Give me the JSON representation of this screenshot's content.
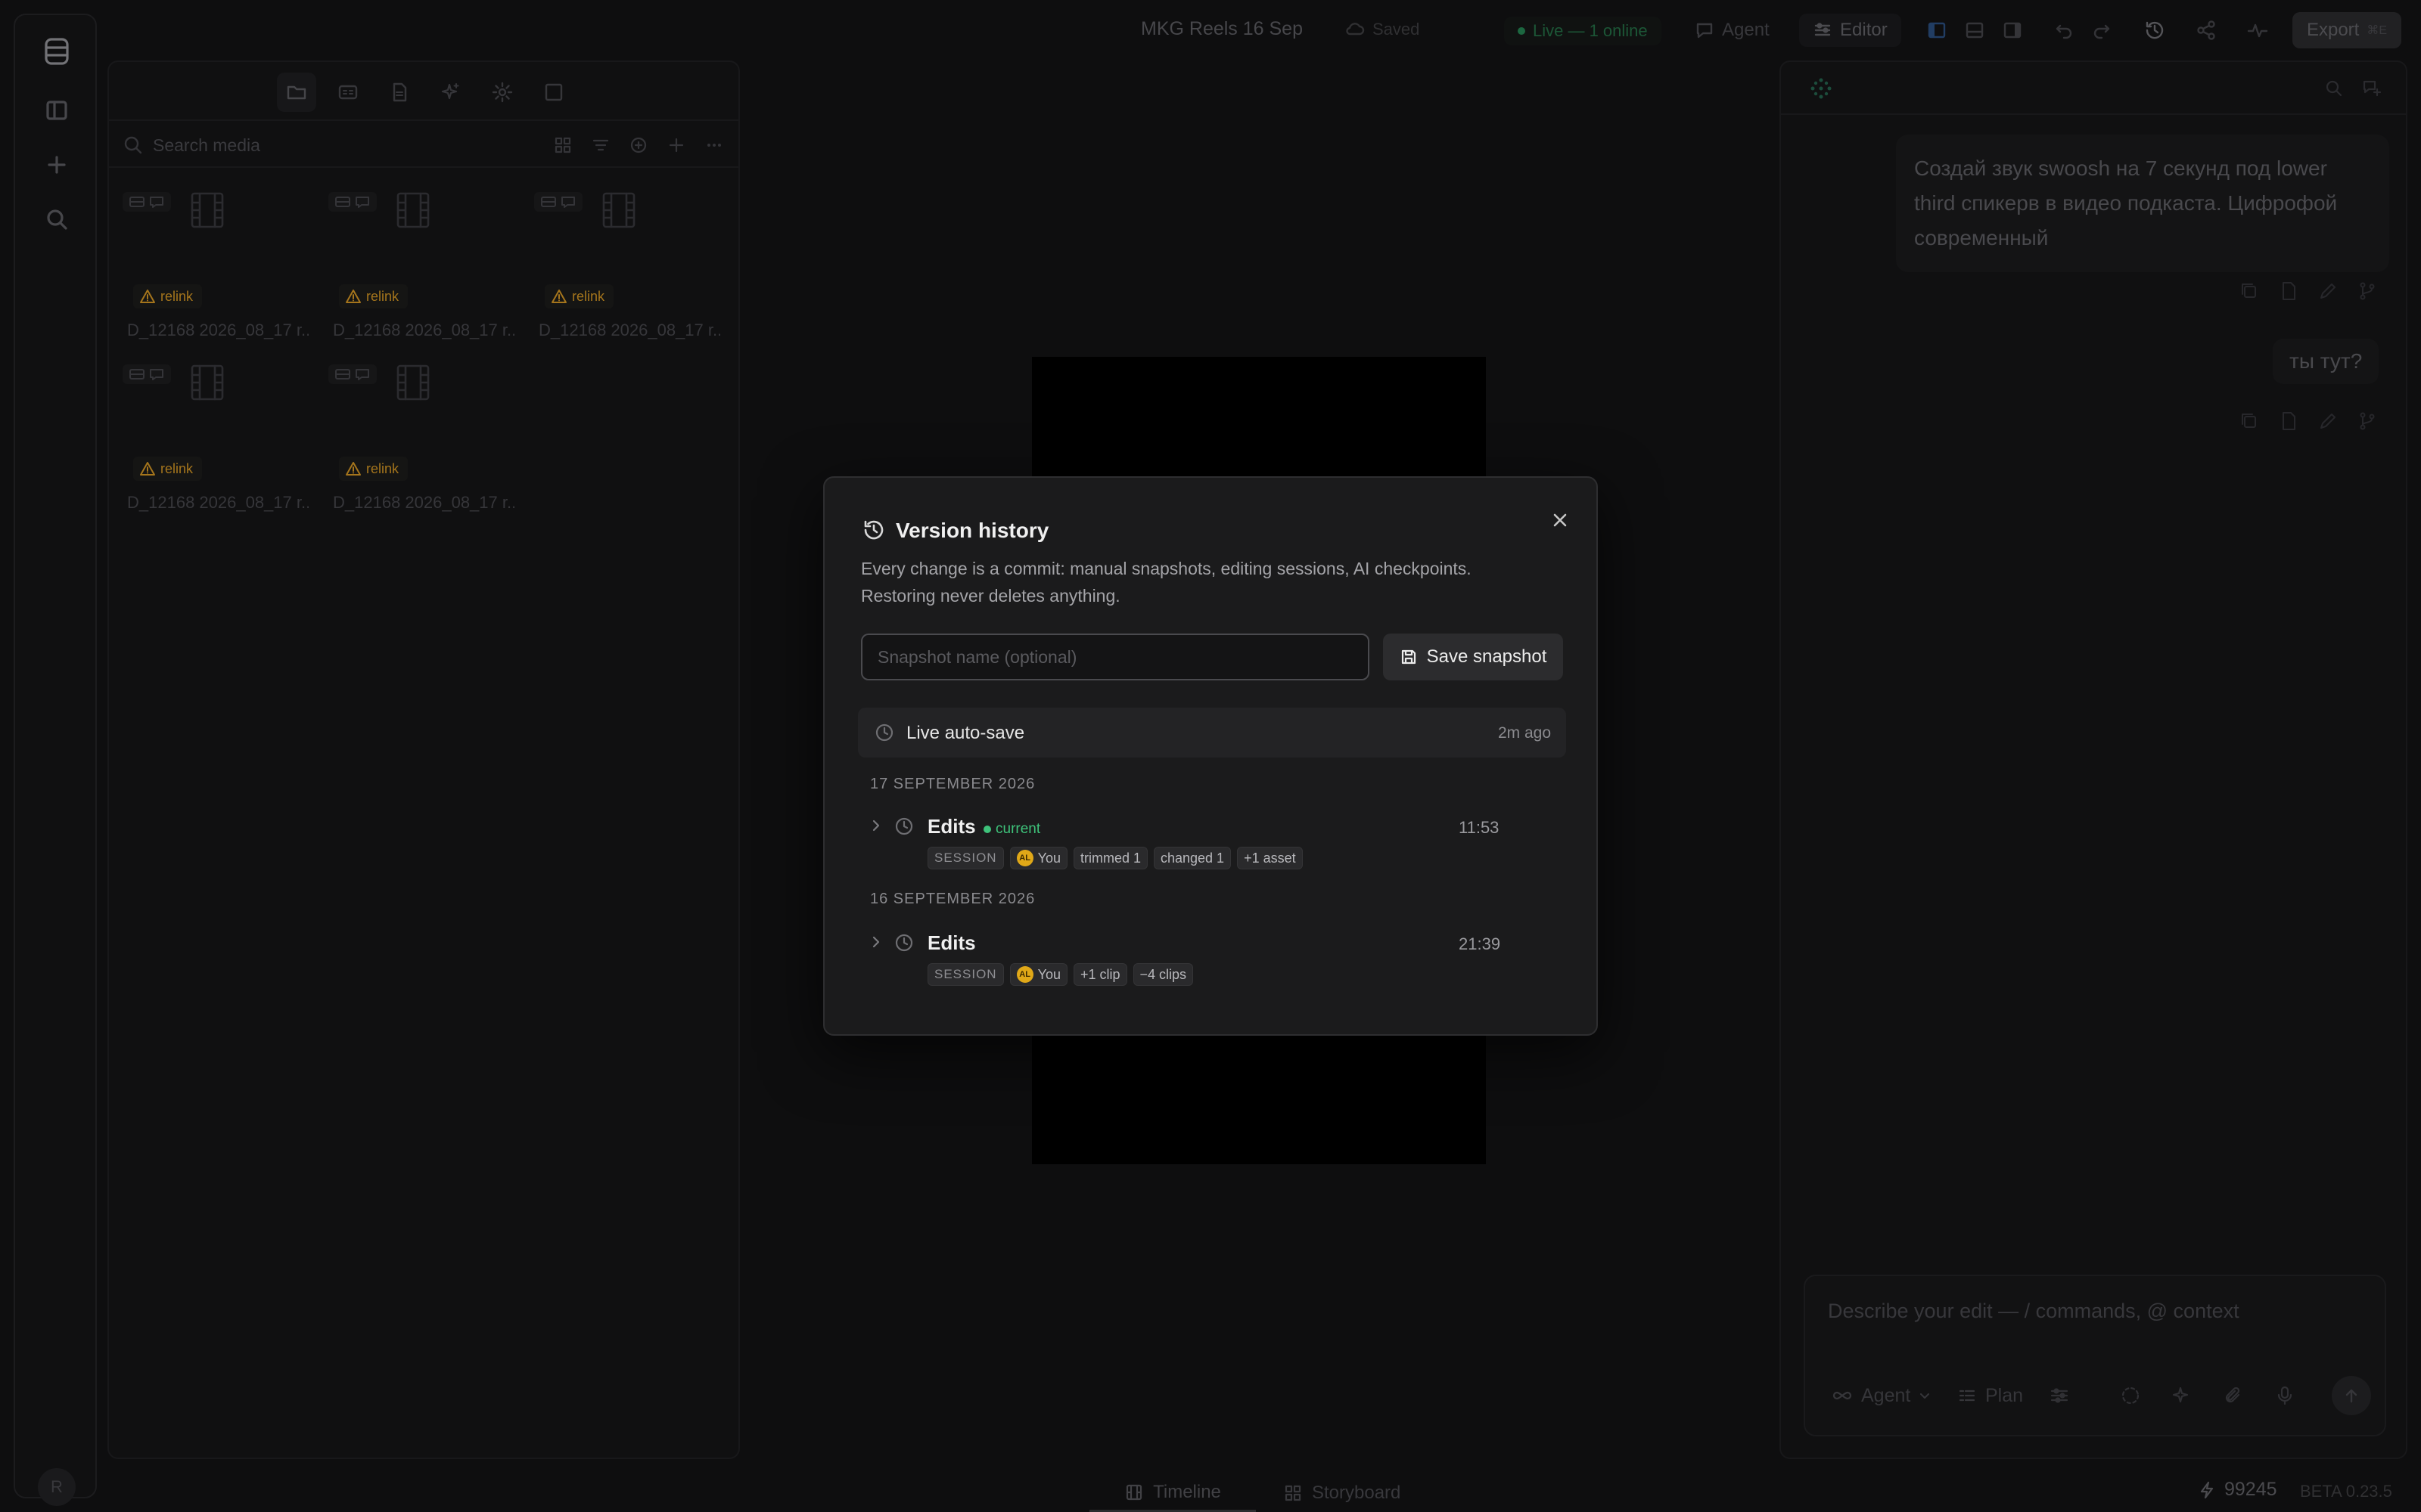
{
  "topbar": {
    "project_title": "MKG Reels 16 Sep",
    "saved_label": "Saved",
    "live_label": "Live — 1 online",
    "agent_label": "Agent",
    "editor_label": "Editor",
    "export_label": "Export",
    "export_shortcut": "⌘E"
  },
  "media": {
    "search_placeholder": "Search media",
    "relink_label": "relink",
    "items": [
      {
        "name": "D_12168 2026_08_17 r..."
      },
      {
        "name": "D_12168 2026_08_17 r..."
      },
      {
        "name": "D_12168 2026_08_17 r..."
      },
      {
        "name": "D_12168 2026_08_17 r..."
      },
      {
        "name": "D_12168 2026_08_17 r..."
      }
    ]
  },
  "chat": {
    "messages": [
      {
        "text": "Создай звук swoosh на 7 секунд под lower third спикерв в видео подкаста. Цифрофой современный"
      },
      {
        "text": "ты тут?"
      }
    ],
    "composer_placeholder": "Describe your edit — / commands, @ context",
    "agent_mode_label": "Agent",
    "plan_label": "Plan"
  },
  "bottom": {
    "timeline_label": "Timeline",
    "storyboard_label": "Storyboard",
    "credits": "99245",
    "version": "BETA 0.23.5"
  },
  "rail": {
    "avatar_initial": "R"
  },
  "modal": {
    "title": "Version history",
    "description": "Every change is a commit: manual snapshots, editing sessions, AI checkpoints. Restoring never deletes anything.",
    "snapshot_placeholder": "Snapshot name (optional)",
    "save_snapshot_label": "Save snapshot",
    "autosave": {
      "label": "Live auto-save",
      "time": "2m ago"
    },
    "groups": [
      {
        "date": "17 SEPTEMBER 2026",
        "entries": [
          {
            "title": "Edits",
            "current_label": "current",
            "time": "11:53",
            "chips": [
              "SESSION",
              "You",
              "trimmed 1",
              "changed 1",
              "+1 asset"
            ]
          }
        ]
      },
      {
        "date": "16 SEPTEMBER 2026",
        "entries": [
          {
            "title": "Edits",
            "time": "21:39",
            "chips": [
              "SESSION",
              "You",
              "+1 clip",
              "−4 clips"
            ]
          }
        ]
      }
    ],
    "avatar_initials": "AL"
  },
  "colors": {
    "accent_green": "#3ec27a",
    "warning": "#b07d1e",
    "avatar": "#e0a818"
  }
}
